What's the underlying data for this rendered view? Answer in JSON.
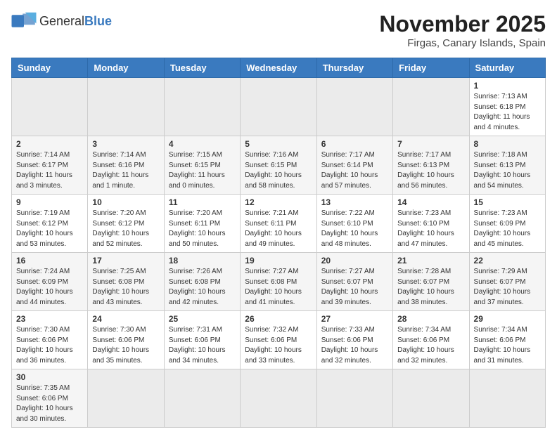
{
  "header": {
    "logo_general": "General",
    "logo_blue": "Blue",
    "month_title": "November 2025",
    "location": "Firgas, Canary Islands, Spain"
  },
  "weekdays": [
    "Sunday",
    "Monday",
    "Tuesday",
    "Wednesday",
    "Thursday",
    "Friday",
    "Saturday"
  ],
  "weeks": [
    [
      {
        "day": "",
        "info": ""
      },
      {
        "day": "",
        "info": ""
      },
      {
        "day": "",
        "info": ""
      },
      {
        "day": "",
        "info": ""
      },
      {
        "day": "",
        "info": ""
      },
      {
        "day": "",
        "info": ""
      },
      {
        "day": "1",
        "info": "Sunrise: 7:13 AM\nSunset: 6:18 PM\nDaylight: 11 hours\nand 4 minutes."
      }
    ],
    [
      {
        "day": "2",
        "info": "Sunrise: 7:14 AM\nSunset: 6:17 PM\nDaylight: 11 hours\nand 3 minutes."
      },
      {
        "day": "3",
        "info": "Sunrise: 7:14 AM\nSunset: 6:16 PM\nDaylight: 11 hours\nand 1 minute."
      },
      {
        "day": "4",
        "info": "Sunrise: 7:15 AM\nSunset: 6:15 PM\nDaylight: 11 hours\nand 0 minutes."
      },
      {
        "day": "5",
        "info": "Sunrise: 7:16 AM\nSunset: 6:15 PM\nDaylight: 10 hours\nand 58 minutes."
      },
      {
        "day": "6",
        "info": "Sunrise: 7:17 AM\nSunset: 6:14 PM\nDaylight: 10 hours\nand 57 minutes."
      },
      {
        "day": "7",
        "info": "Sunrise: 7:17 AM\nSunset: 6:13 PM\nDaylight: 10 hours\nand 56 minutes."
      },
      {
        "day": "8",
        "info": "Sunrise: 7:18 AM\nSunset: 6:13 PM\nDaylight: 10 hours\nand 54 minutes."
      }
    ],
    [
      {
        "day": "9",
        "info": "Sunrise: 7:19 AM\nSunset: 6:12 PM\nDaylight: 10 hours\nand 53 minutes."
      },
      {
        "day": "10",
        "info": "Sunrise: 7:20 AM\nSunset: 6:12 PM\nDaylight: 10 hours\nand 52 minutes."
      },
      {
        "day": "11",
        "info": "Sunrise: 7:20 AM\nSunset: 6:11 PM\nDaylight: 10 hours\nand 50 minutes."
      },
      {
        "day": "12",
        "info": "Sunrise: 7:21 AM\nSunset: 6:11 PM\nDaylight: 10 hours\nand 49 minutes."
      },
      {
        "day": "13",
        "info": "Sunrise: 7:22 AM\nSunset: 6:10 PM\nDaylight: 10 hours\nand 48 minutes."
      },
      {
        "day": "14",
        "info": "Sunrise: 7:23 AM\nSunset: 6:10 PM\nDaylight: 10 hours\nand 47 minutes."
      },
      {
        "day": "15",
        "info": "Sunrise: 7:23 AM\nSunset: 6:09 PM\nDaylight: 10 hours\nand 45 minutes."
      }
    ],
    [
      {
        "day": "16",
        "info": "Sunrise: 7:24 AM\nSunset: 6:09 PM\nDaylight: 10 hours\nand 44 minutes."
      },
      {
        "day": "17",
        "info": "Sunrise: 7:25 AM\nSunset: 6:08 PM\nDaylight: 10 hours\nand 43 minutes."
      },
      {
        "day": "18",
        "info": "Sunrise: 7:26 AM\nSunset: 6:08 PM\nDaylight: 10 hours\nand 42 minutes."
      },
      {
        "day": "19",
        "info": "Sunrise: 7:27 AM\nSunset: 6:08 PM\nDaylight: 10 hours\nand 41 minutes."
      },
      {
        "day": "20",
        "info": "Sunrise: 7:27 AM\nSunset: 6:07 PM\nDaylight: 10 hours\nand 39 minutes."
      },
      {
        "day": "21",
        "info": "Sunrise: 7:28 AM\nSunset: 6:07 PM\nDaylight: 10 hours\nand 38 minutes."
      },
      {
        "day": "22",
        "info": "Sunrise: 7:29 AM\nSunset: 6:07 PM\nDaylight: 10 hours\nand 37 minutes."
      }
    ],
    [
      {
        "day": "23",
        "info": "Sunrise: 7:30 AM\nSunset: 6:06 PM\nDaylight: 10 hours\nand 36 minutes."
      },
      {
        "day": "24",
        "info": "Sunrise: 7:30 AM\nSunset: 6:06 PM\nDaylight: 10 hours\nand 35 minutes."
      },
      {
        "day": "25",
        "info": "Sunrise: 7:31 AM\nSunset: 6:06 PM\nDaylight: 10 hours\nand 34 minutes."
      },
      {
        "day": "26",
        "info": "Sunrise: 7:32 AM\nSunset: 6:06 PM\nDaylight: 10 hours\nand 33 minutes."
      },
      {
        "day": "27",
        "info": "Sunrise: 7:33 AM\nSunset: 6:06 PM\nDaylight: 10 hours\nand 32 minutes."
      },
      {
        "day": "28",
        "info": "Sunrise: 7:34 AM\nSunset: 6:06 PM\nDaylight: 10 hours\nand 32 minutes."
      },
      {
        "day": "29",
        "info": "Sunrise: 7:34 AM\nSunset: 6:06 PM\nDaylight: 10 hours\nand 31 minutes."
      }
    ],
    [
      {
        "day": "30",
        "info": "Sunrise: 7:35 AM\nSunset: 6:06 PM\nDaylight: 10 hours\nand 30 minutes."
      },
      {
        "day": "",
        "info": ""
      },
      {
        "day": "",
        "info": ""
      },
      {
        "day": "",
        "info": ""
      },
      {
        "day": "",
        "info": ""
      },
      {
        "day": "",
        "info": ""
      },
      {
        "day": "",
        "info": ""
      }
    ]
  ]
}
